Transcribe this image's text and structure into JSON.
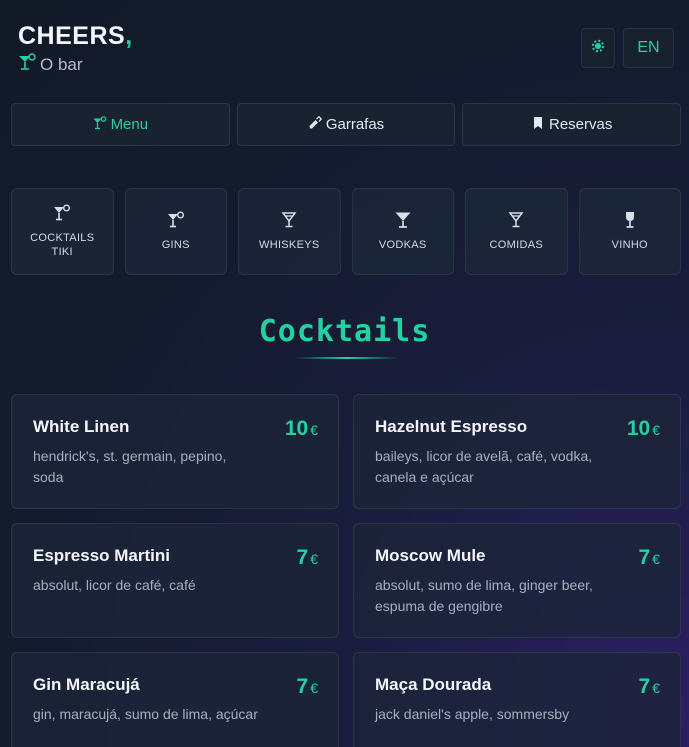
{
  "brand": {
    "name": "CHEERS",
    "comma": ",",
    "subtitle": "O bar"
  },
  "language": "EN",
  "nav": [
    {
      "label": "Menu",
      "icon": "cocktail-icon",
      "active": true
    },
    {
      "label": "Garrafas",
      "icon": "bottle-icon",
      "active": false
    },
    {
      "label": "Reservas",
      "icon": "bookmark-icon",
      "active": false
    }
  ],
  "categories": [
    {
      "label": "COCKTAILS\nTIKI",
      "icon": "cocktail-icon"
    },
    {
      "label": "GINS",
      "icon": "cocktail-icon"
    },
    {
      "label": "WHISKEYS",
      "icon": "martini-icon"
    },
    {
      "label": "VODKAS",
      "icon": "martini-glass-icon"
    },
    {
      "label": "COMIDAS",
      "icon": "martini-icon"
    },
    {
      "label": "VINHO",
      "icon": "wine-glass-icon"
    }
  ],
  "section": {
    "title": "Cocktails"
  },
  "items": [
    {
      "name": "White Linen",
      "desc": "hendrick's, st. germain, pepino, soda",
      "price": "10",
      "currency": "€"
    },
    {
      "name": "Hazelnut Espresso",
      "desc": "baileys, licor de avelã, café, vodka, canela e açúcar",
      "price": "10",
      "currency": "€"
    },
    {
      "name": "Espresso Martini",
      "desc": "absolut, licor de café, café",
      "price": "7",
      "currency": "€"
    },
    {
      "name": "Moscow Mule",
      "desc": "absolut, sumo de lima, ginger beer, espuma de gengibre",
      "price": "7",
      "currency": "€"
    },
    {
      "name": "Gin Maracujá",
      "desc": "gin, maracujá, sumo de lima, açúcar",
      "price": "7",
      "currency": "€"
    },
    {
      "name": "Maça Dourada",
      "desc": "jack daniel's apple, sommersby",
      "price": "7",
      "currency": "€"
    }
  ],
  "colors": {
    "accent": "#22d3a0",
    "background": "#141b2c",
    "card": "#1c2538"
  }
}
